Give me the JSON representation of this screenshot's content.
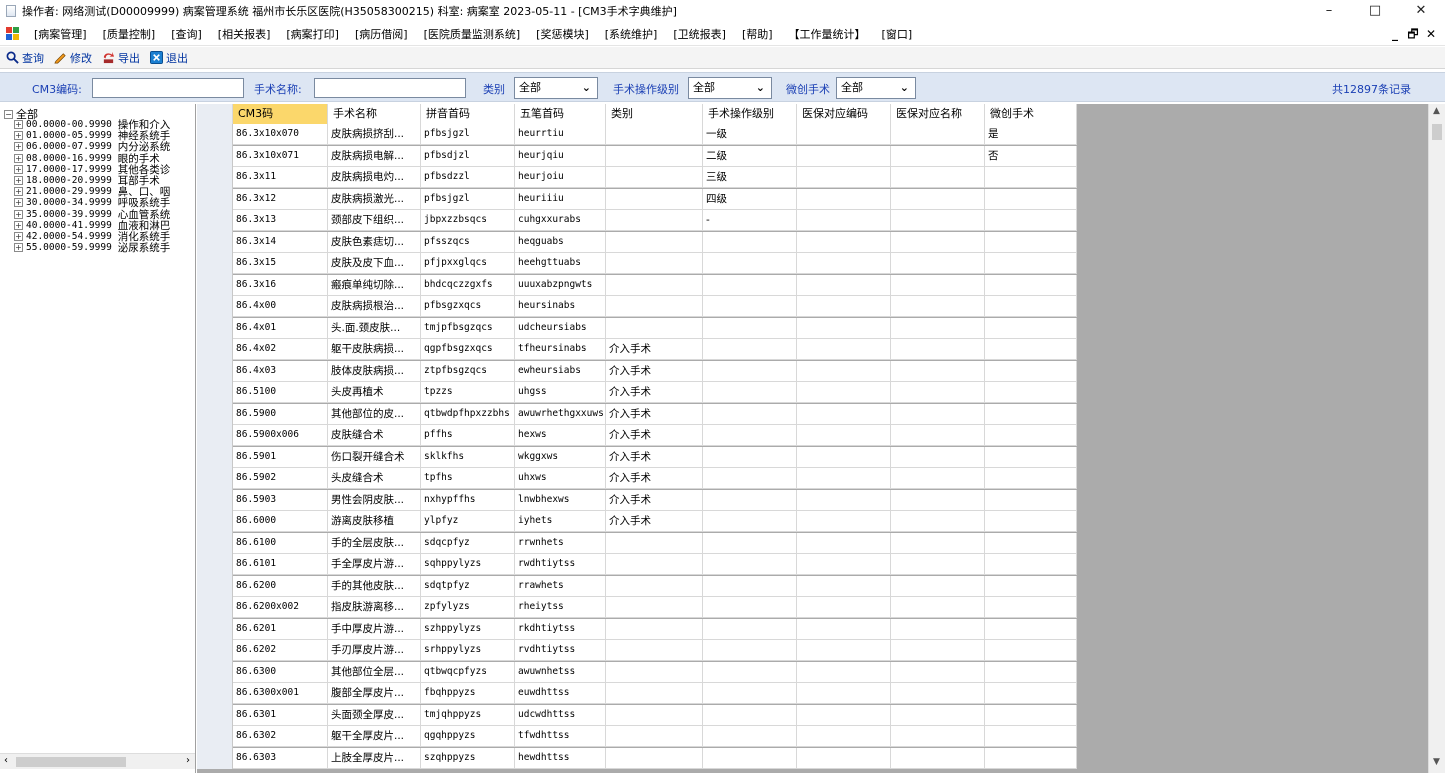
{
  "window": {
    "title": "操作者: 网络测试(D00009999) 病案管理系统 福州市长乐区医院(H35058300215) 科室: 病案室 2023-05-11 - [CM3手术字典维护]",
    "minimize": "–",
    "maximize": "□",
    "close": "✕"
  },
  "menu": {
    "items": [
      "[病案管理]",
      "[质量控制]",
      "[查询]",
      "[相关报表]",
      "[病案打印]",
      "[病历借阅]",
      "[医院质量监测系统]",
      "[奖惩模块]",
      "[系统维护]",
      "[卫统报表]",
      "[帮助]",
      "【工作量统计】",
      "[窗口]"
    ],
    "mdi_min": "_",
    "mdi_restore": "🗗",
    "mdi_close": "✕"
  },
  "toolbar": {
    "query": "查询",
    "modify": "修改",
    "export": "导出",
    "exit": "退出"
  },
  "filters": {
    "code_label": "CM3编码:",
    "code_value": "",
    "name_label": "手术名称:",
    "name_value": "",
    "category_label": "类别",
    "category_value": "全部",
    "level_label": "手术操作级别",
    "level_value": "全部",
    "minimal_label": "微创手术",
    "minimal_value": "全部",
    "record_count": "共12897条记录"
  },
  "tree": {
    "root": "全部",
    "nodes": [
      {
        "code": "00.0000-00.9990",
        "name": "操作和介入"
      },
      {
        "code": "01.0000-05.9999",
        "name": "神经系统手"
      },
      {
        "code": "06.0000-07.9999",
        "name": "内分泌系统"
      },
      {
        "code": "08.0000-16.9999",
        "name": "眼的手术"
      },
      {
        "code": "17.0000-17.9999",
        "name": "其他各类诊"
      },
      {
        "code": "18.0000-20.9999",
        "name": "耳部手术"
      },
      {
        "code": "21.0000-29.9999",
        "name": "鼻、口、咽"
      },
      {
        "code": "30.0000-34.9999",
        "name": "呼吸系统手"
      },
      {
        "code": "35.0000-39.9999",
        "name": "心血管系统"
      },
      {
        "code": "40.0000-41.9999",
        "name": "血液和淋巴"
      },
      {
        "code": "42.0000-54.9999",
        "name": "消化系统手"
      },
      {
        "code": "55.0000-59.9999",
        "name": "泌尿系统手"
      }
    ]
  },
  "grid": {
    "columns": [
      "CM3码",
      "手术名称",
      "拼音首码",
      "五笔首码",
      "类别",
      "手术操作级别",
      "医保对应编码",
      "医保对应名称",
      "微创手术"
    ],
    "rows": [
      [
        "86.3x10x070",
        "皮肤病损挤刮...",
        "pfbsjgzl",
        "heurrtiu",
        "",
        "一级",
        "",
        "",
        "是"
      ],
      [
        "86.3x10x071",
        "皮肤病损电解...",
        "pfbsdjzl",
        "heurjqiu",
        "",
        "二级",
        "",
        "",
        "否"
      ],
      [
        "86.3x11",
        "皮肤病损电灼...",
        "pfbsdzzl",
        "heurjoiu",
        "",
        "三级",
        "",
        "",
        ""
      ],
      [
        "86.3x12",
        "皮肤病损激光...",
        "pfbsjgzl",
        "heuriiiu",
        "",
        "四级",
        "",
        "",
        ""
      ],
      [
        "86.3x13",
        "颈部皮下组织...",
        "jbpxzzbsqcs",
        "cuhgxxurabs",
        "",
        "-",
        "",
        "",
        ""
      ],
      [
        "86.3x14",
        "皮肤色素痣切...",
        "pfsszqcs",
        "heqguabs",
        "",
        "",
        "",
        "",
        ""
      ],
      [
        "86.3x15",
        "皮肤及皮下血...",
        "pfjpxxglqcs",
        "heehgttuabs",
        "",
        "",
        "",
        "",
        ""
      ],
      [
        "86.3x16",
        "瘢痕单纯切除...",
        "bhdcqczzgxfs",
        "uuuxabzpngwts",
        "",
        "",
        "",
        "",
        ""
      ],
      [
        "86.4x00",
        "皮肤病损根治...",
        "pfbsgzxqcs",
        "heursinabs",
        "",
        "",
        "",
        "",
        ""
      ],
      [
        "86.4x01",
        "头.面.颈皮肤...",
        "tmjpfbsgzqcs",
        "udcheursiabs",
        "",
        "",
        "",
        "",
        ""
      ],
      [
        "86.4x02",
        "躯干皮肤病损...",
        "qgpfbsgzxqcs",
        "tfheursinabs",
        "介入手术",
        "",
        "",
        "",
        ""
      ],
      [
        "86.4x03",
        "肢体皮肤病损...",
        "ztpfbsgzqcs",
        "ewheursiabs",
        "介入手术",
        "",
        "",
        "",
        ""
      ],
      [
        "86.5100",
        "头皮再植术",
        "tpzzs",
        "uhgss",
        "介入手术",
        "",
        "",
        "",
        ""
      ],
      [
        "86.5900",
        "其他部位的皮...",
        "qtbwdpfhpxzzbhs",
        "awuwrhethgxxuws",
        "介入手术",
        "",
        "",
        "",
        ""
      ],
      [
        "86.5900x006",
        "皮肤缝合术",
        "pffhs",
        "hexws",
        "介入手术",
        "",
        "",
        "",
        ""
      ],
      [
        "86.5901",
        "伤口裂开缝合术",
        "sklkfhs",
        "wkggxws",
        "介入手术",
        "",
        "",
        "",
        ""
      ],
      [
        "86.5902",
        "头皮缝合术",
        "tpfhs",
        "uhxws",
        "介入手术",
        "",
        "",
        "",
        ""
      ],
      [
        "86.5903",
        "男性会阴皮肤...",
        "nxhypffhs",
        "lnwbhexws",
        "介入手术",
        "",
        "",
        "",
        ""
      ],
      [
        "86.6000",
        "游离皮肤移植",
        "ylpfyz",
        "iyhets",
        "介入手术",
        "",
        "",
        "",
        ""
      ],
      [
        "86.6100",
        "手的全层皮肤...",
        "sdqcpfyz",
        "rrwnhets",
        "",
        "",
        "",
        "",
        ""
      ],
      [
        "86.6101",
        "手全厚皮片游...",
        "sqhppylyzs",
        "rwdhtiytss",
        "",
        "",
        "",
        "",
        ""
      ],
      [
        "86.6200",
        "手的其他皮肤...",
        "sdqtpfyz",
        "rrawhets",
        "",
        "",
        "",
        "",
        ""
      ],
      [
        "86.6200x002",
        "指皮肤游离移...",
        "zpfylyzs",
        "rheiytss",
        "",
        "",
        "",
        "",
        ""
      ],
      [
        "86.6201",
        "手中厚皮片游...",
        "szhppylyzs",
        "rkdhtiytss",
        "",
        "",
        "",
        "",
        ""
      ],
      [
        "86.6202",
        "手刃厚皮片游...",
        "srhppylyzs",
        "rvdhtiytss",
        "",
        "",
        "",
        "",
        ""
      ],
      [
        "86.6300",
        "其他部位全层...",
        "qtbwqcpfyzs",
        "awuwnhetss",
        "",
        "",
        "",
        "",
        ""
      ],
      [
        "86.6300x001",
        "腹部全厚皮片...",
        "fbqhppyzs",
        "euwdhttss",
        "",
        "",
        "",
        "",
        ""
      ],
      [
        "86.6301",
        "头面颈全厚皮...",
        "tmjqhppyzs",
        "udcwdhttss",
        "",
        "",
        "",
        "",
        ""
      ],
      [
        "86.6302",
        "躯干全厚皮片...",
        "qgqhppyzs",
        "tfwdhttss",
        "",
        "",
        "",
        "",
        ""
      ],
      [
        "86.6303",
        "上肢全厚皮片...",
        "szqhppyzs",
        "hewdhttss",
        "",
        "",
        "",
        "",
        ""
      ]
    ]
  },
  "colors": {
    "sorted_header": "#fbd76b",
    "filter_bg": "#dde6f3",
    "grid_bg": "#ababab",
    "label_blue": "#1a3fb4"
  }
}
